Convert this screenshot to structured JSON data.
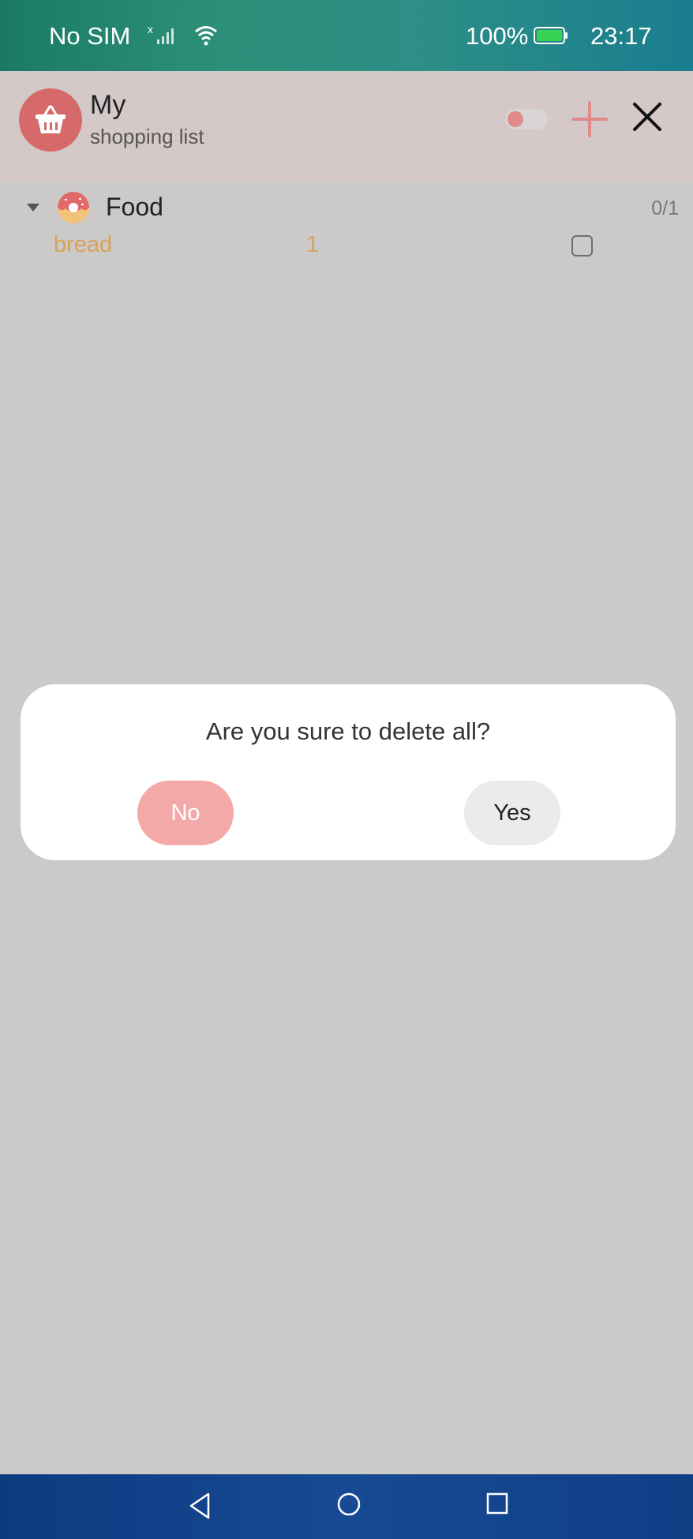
{
  "status_bar": {
    "carrier": "No SIM",
    "battery_percent": "100%",
    "time": "23:17",
    "battery_color": "#39d353"
  },
  "header": {
    "title": "My",
    "subtitle": "shopping list",
    "accent_color": "#d66a6a",
    "toggle_on": false
  },
  "list": {
    "categories": [
      {
        "name": "Food",
        "count": "0/1",
        "expanded": true,
        "items": [
          {
            "name": "bread",
            "quantity": "1",
            "checked": false
          }
        ]
      }
    ]
  },
  "dialog": {
    "message": "Are you sure to delete all?",
    "no_label": "No",
    "yes_label": "Yes"
  },
  "icons": {
    "app": "shopping-basket-icon",
    "add": "plus-icon",
    "close": "close-icon",
    "category": "donut-icon"
  }
}
